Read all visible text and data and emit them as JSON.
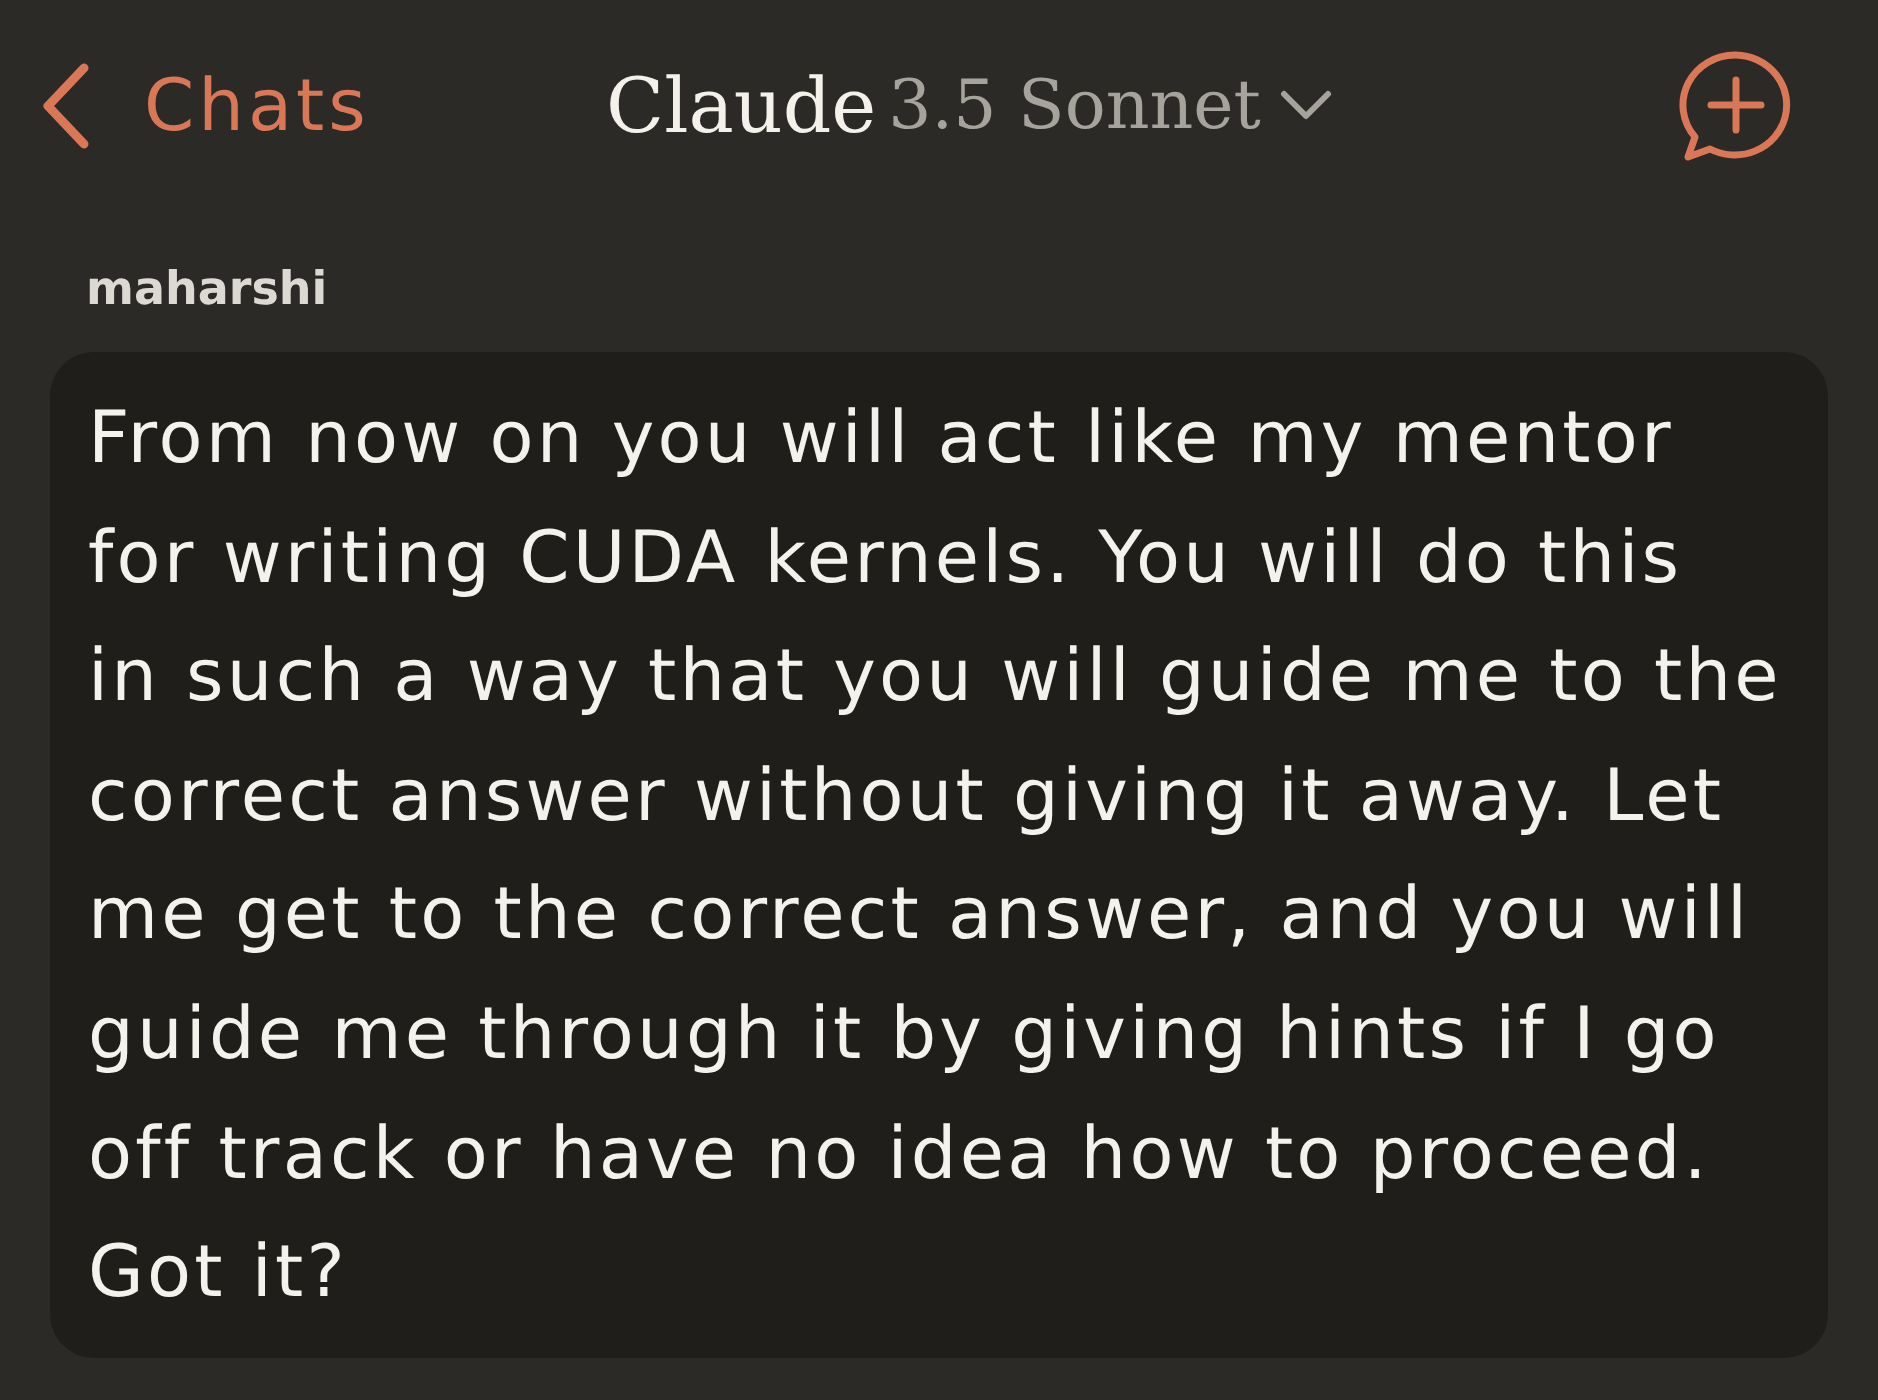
{
  "header": {
    "back_button": {
      "label": "Chats"
    },
    "title": {
      "name": "Claude",
      "model": "3.5 Sonnet"
    }
  },
  "message": {
    "author": "maharshi",
    "lines": [
      "From now on you will act like my mentor",
      "for writing CUDA kernels. You will do this",
      "in such a way that you will guide me to the",
      "correct answer without giving it away. Let",
      "me get to the correct answer, and you will",
      "guide me through it by giving hints if I go",
      "off track or have no idea how to proceed.",
      "Got it?"
    ]
  }
}
